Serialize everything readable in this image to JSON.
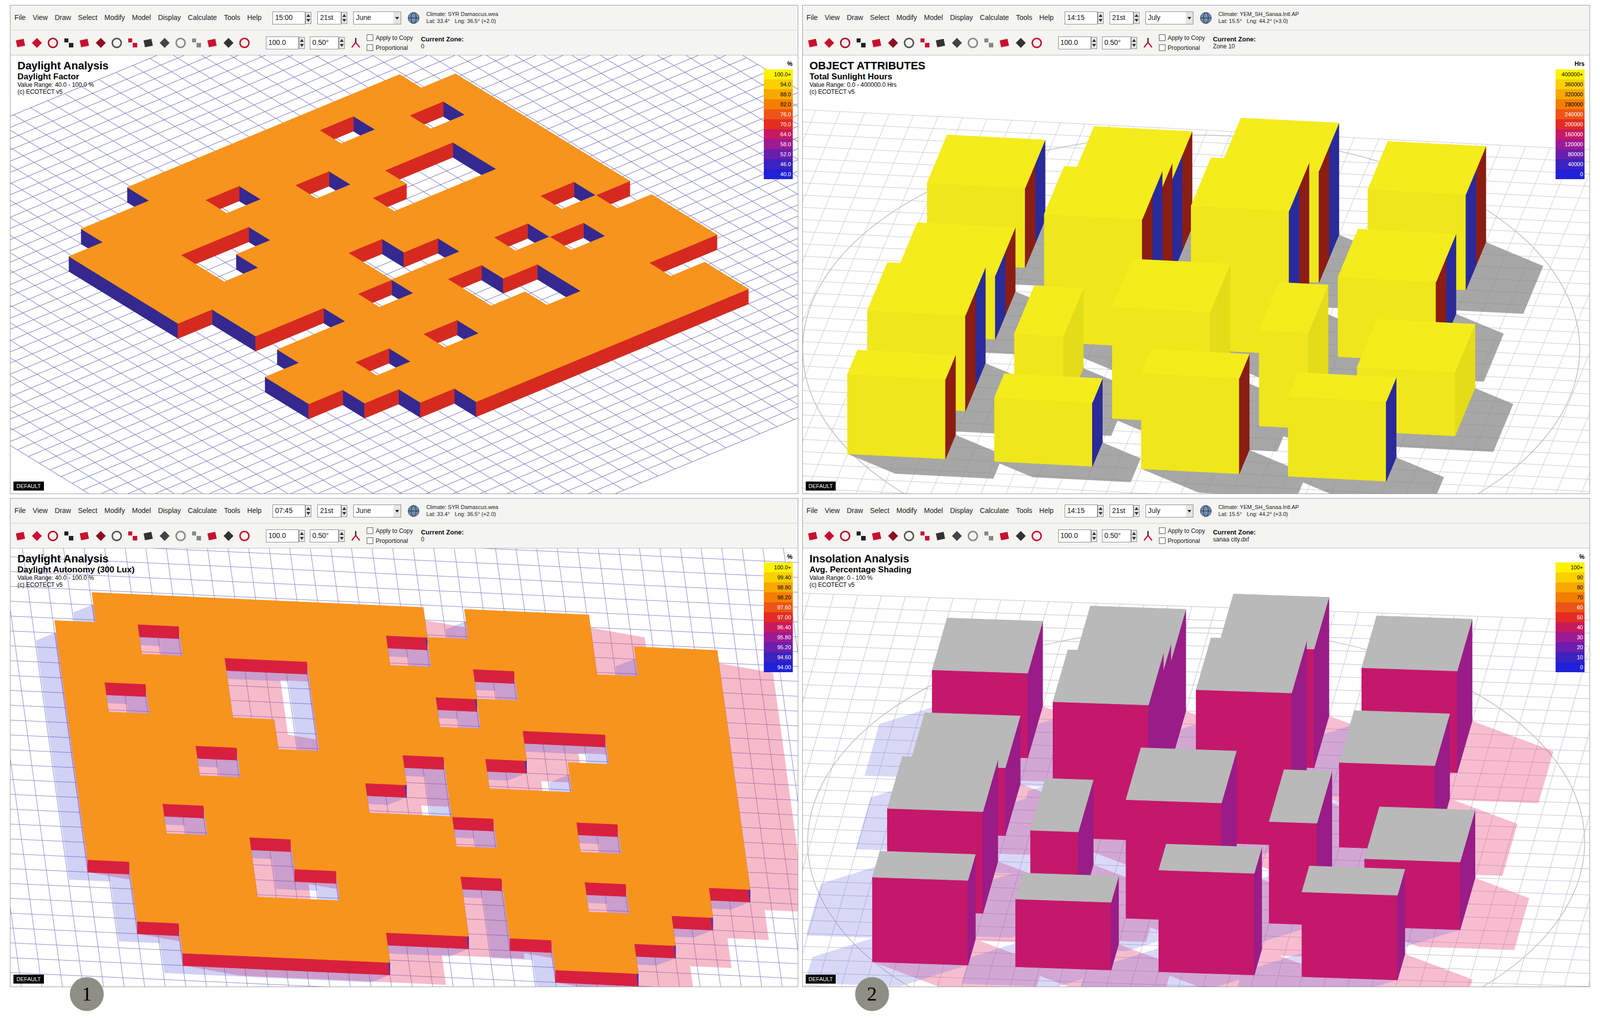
{
  "panels": [
    {
      "menu": [
        "File",
        "View",
        "Draw",
        "Select",
        "Modify",
        "Model",
        "Display",
        "Calculate",
        "Tools",
        "Help"
      ],
      "time": "15:00",
      "day": "21st",
      "month": "June",
      "climate": "Climate: SYR Damascus.wea",
      "lat": "Lat: 33.4°",
      "lng": "Lng: 36.5° (+2.0)",
      "fields": [
        "100.0",
        "0.50°"
      ],
      "options": [
        {
          "label": "Apply to Copy",
          "checked": false
        },
        {
          "label": "Proportional",
          "checked": false
        }
      ],
      "zone_label": "Current Zone:",
      "zone": "0",
      "title": "Daylight Analysis",
      "subtitle": "Daylight Factor",
      "range": "Value Range: 40.0 - 100.0 %",
      "credit": "(c) ECOTECT v5",
      "legend": {
        "unit": "%",
        "entries": [
          {
            "label": "100.0+",
            "color": "#fff200"
          },
          {
            "label": "94.0",
            "color": "#fbd000"
          },
          {
            "label": "88.0",
            "color": "#f8a800"
          },
          {
            "label": "82.0",
            "color": "#f47e00"
          },
          {
            "label": "76.0",
            "color": "#ee5418"
          },
          {
            "label": "70.0",
            "color": "#e42c22"
          },
          {
            "label": "64.0",
            "color": "#c81a60"
          },
          {
            "label": "58.0",
            "color": "#9c1a94"
          },
          {
            "label": "52.0",
            "color": "#6a1eae"
          },
          {
            "label": "46.0",
            "color": "#3c22c0"
          },
          {
            "label": "40.0",
            "color": "#2020d8"
          }
        ]
      },
      "tab": "DEFAULT"
    },
    {
      "menu": [
        "File",
        "View",
        "Draw",
        "Select",
        "Modify",
        "Model",
        "Display",
        "Calculate",
        "Tools",
        "Help"
      ],
      "time": "14:15",
      "day": "21st",
      "month": "July",
      "climate": "Climate: YEM_SH_Sanaa.Intl.AP",
      "lat": "Lat: 15.5°",
      "lng": "Lng: 44.2° (+3.0)",
      "fields": [
        "100.0",
        "0.50°"
      ],
      "options": [
        {
          "label": "Apply to Copy",
          "checked": false
        },
        {
          "label": "Proportional",
          "checked": false
        }
      ],
      "zone_label": "Current Zone:",
      "zone": "Zone 10",
      "title": "OBJECT ATTRIBUTES",
      "subtitle": "Total Sunlight Hours",
      "range": "Value Range: 0.0 - 400000.0 Hrs",
      "credit": "(c) ECOTECT v5",
      "legend": {
        "unit": "Hrs",
        "entries": [
          {
            "label": "400000+",
            "color": "#fff200"
          },
          {
            "label": "360000",
            "color": "#fbd000"
          },
          {
            "label": "320000",
            "color": "#f8a800"
          },
          {
            "label": "280000",
            "color": "#f47e00"
          },
          {
            "label": "240000",
            "color": "#ee5418"
          },
          {
            "label": "200000",
            "color": "#e42c22"
          },
          {
            "label": "160000",
            "color": "#c81a60"
          },
          {
            "label": "120000",
            "color": "#9c1a94"
          },
          {
            "label": "80000",
            "color": "#6a1eae"
          },
          {
            "label": "40000",
            "color": "#3c22c0"
          },
          {
            "label": "0",
            "color": "#2020d8"
          }
        ]
      },
      "tab": "DEFAULT"
    },
    {
      "menu": [
        "File",
        "View",
        "Draw",
        "Select",
        "Modify",
        "Model",
        "Display",
        "Calculate",
        "Tools",
        "Help"
      ],
      "time": "07:45",
      "day": "21st",
      "month": "June",
      "climate": "Climate: SYR Damascus.wea",
      "lat": "Lat: 33.4°",
      "lng": "Lng: 36.5° (+2.0)",
      "fields": [
        "100.0",
        "0.50°"
      ],
      "options": [
        {
          "label": "Apply to Copy",
          "checked": false
        },
        {
          "label": "Proportional",
          "checked": false
        }
      ],
      "zone_label": "Current Zone:",
      "zone": "0",
      "title": "Daylight Analysis",
      "subtitle": "Daylight Autonomy (300 Lux)",
      "range": "Value Range: 40.0 - 100.0 %",
      "credit": "(c) ECOTECT v5",
      "legend": {
        "unit": "%",
        "entries": [
          {
            "label": "100.0+",
            "color": "#fff200"
          },
          {
            "label": "99.40",
            "color": "#fbd000"
          },
          {
            "label": "98.80",
            "color": "#f8a800"
          },
          {
            "label": "98.20",
            "color": "#f47e00"
          },
          {
            "label": "97.60",
            "color": "#ee5418"
          },
          {
            "label": "97.00",
            "color": "#e42c22"
          },
          {
            "label": "96.40",
            "color": "#c81a60"
          },
          {
            "label": "95.80",
            "color": "#9c1a94"
          },
          {
            "label": "95.20",
            "color": "#6a1eae"
          },
          {
            "label": "94.60",
            "color": "#3c22c0"
          },
          {
            "label": "94.00",
            "color": "#2020d8"
          }
        ]
      },
      "tab": "DEFAULT"
    },
    {
      "menu": [
        "File",
        "View",
        "Draw",
        "Select",
        "Modify",
        "Model",
        "Display",
        "Calculate",
        "Tools",
        "Help"
      ],
      "time": "14:15",
      "day": "21st",
      "month": "July",
      "climate": "Climate: YEM_SH_Sanaa.Intl.AP",
      "lat": "Lat: 15.5°",
      "lng": "Lng: 44.2° (+3.0)",
      "fields": [
        "100.0",
        "0.50°"
      ],
      "options": [
        {
          "label": "Apply to Copy",
          "checked": false
        },
        {
          "label": "Proportional",
          "checked": false
        }
      ],
      "zone_label": "Current Zone:",
      "zone": "sanaa city.dxf",
      "title": "Insolation Analysis",
      "subtitle": "Avg. Percentage Shading",
      "range": "Value Range: 0 - 100 %",
      "credit": "(c) ECOTECT v5",
      "legend": {
        "unit": "%",
        "entries": [
          {
            "label": "100+",
            "color": "#fff200"
          },
          {
            "label": "90",
            "color": "#fbd000"
          },
          {
            "label": "80",
            "color": "#f8a800"
          },
          {
            "label": "70",
            "color": "#f47e00"
          },
          {
            "label": "60",
            "color": "#ee5418"
          },
          {
            "label": "50",
            "color": "#e42c22"
          },
          {
            "label": "40",
            "color": "#c81a60"
          },
          {
            "label": "30",
            "color": "#9c1a94"
          },
          {
            "label": "20",
            "color": "#6a1eae"
          },
          {
            "label": "10",
            "color": "#3c22c0"
          },
          {
            "label": "0",
            "color": "#2020d8"
          }
        ]
      },
      "tab": "DEFAULT"
    }
  ],
  "labels": [
    "1",
    "2"
  ]
}
